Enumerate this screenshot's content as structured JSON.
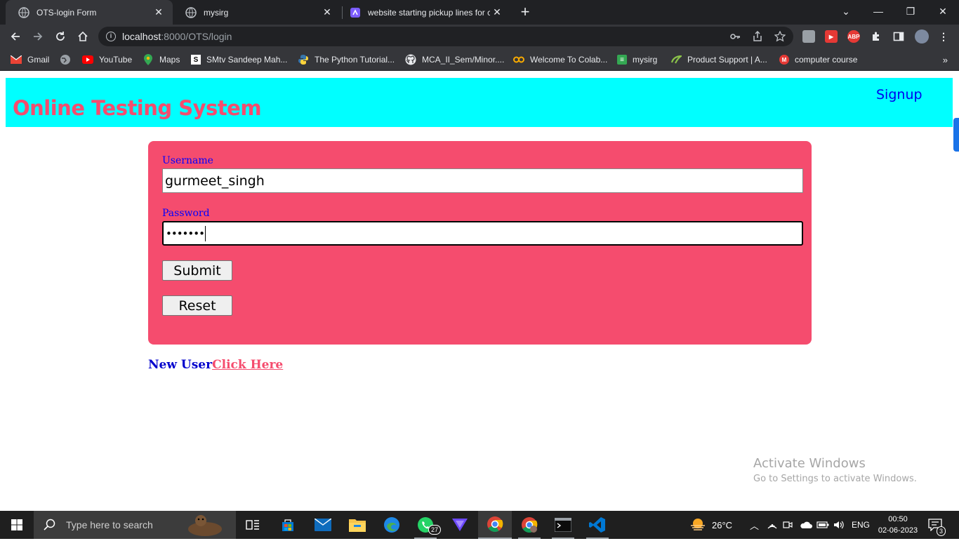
{
  "browser": {
    "tabs": [
      {
        "title": "OTS-login Form",
        "active": true
      },
      {
        "title": "mysirg",
        "active": false
      },
      {
        "title": "website starting pickup lines for c",
        "active": false
      }
    ],
    "address": {
      "host": "localhost",
      "path": ":8000/OTS/login"
    },
    "bookmarks": [
      {
        "label": "Gmail",
        "icon": "gmail-icon"
      },
      {
        "label": "",
        "icon": "globe-icon"
      },
      {
        "label": "YouTube",
        "icon": "youtube-icon"
      },
      {
        "label": "Maps",
        "icon": "maps-icon"
      },
      {
        "label": "SMtv Sandeep Mah...",
        "icon": "s-icon"
      },
      {
        "label": "The Python Tutorial...",
        "icon": "python-icon"
      },
      {
        "label": "MCA_II_Sem/Minor....",
        "icon": "github-icon"
      },
      {
        "label": "Welcome To Colab...",
        "icon": "colab-icon"
      },
      {
        "label": "mysirg",
        "icon": "sheet-icon"
      },
      {
        "label": "Product Support | A...",
        "icon": "product-icon"
      },
      {
        "label": "computer course",
        "icon": "m-icon"
      }
    ]
  },
  "header": {
    "title": "Online Testing System",
    "signup": "Signup"
  },
  "form": {
    "username_label": "Username",
    "username_value": "gurmeet_singh",
    "password_label": "Password",
    "password_mask": "•••••••",
    "submit": "Submit",
    "reset": "Reset"
  },
  "footer": {
    "new_user": "New User",
    "click_here": "Click Here"
  },
  "watermark": {
    "line1": "Activate Windows",
    "line2": "Go to Settings to activate Windows."
  },
  "taskbar": {
    "search_placeholder": "Type here to search",
    "whatsapp_badge": "27",
    "temperature": "26°C",
    "language": "ENG",
    "time": "00:50",
    "date": "02-06-2023",
    "notification_count": "3"
  },
  "colors": {
    "header_bg": "#00ffff",
    "accent": "#f54c6e",
    "link": "#0000ee"
  }
}
